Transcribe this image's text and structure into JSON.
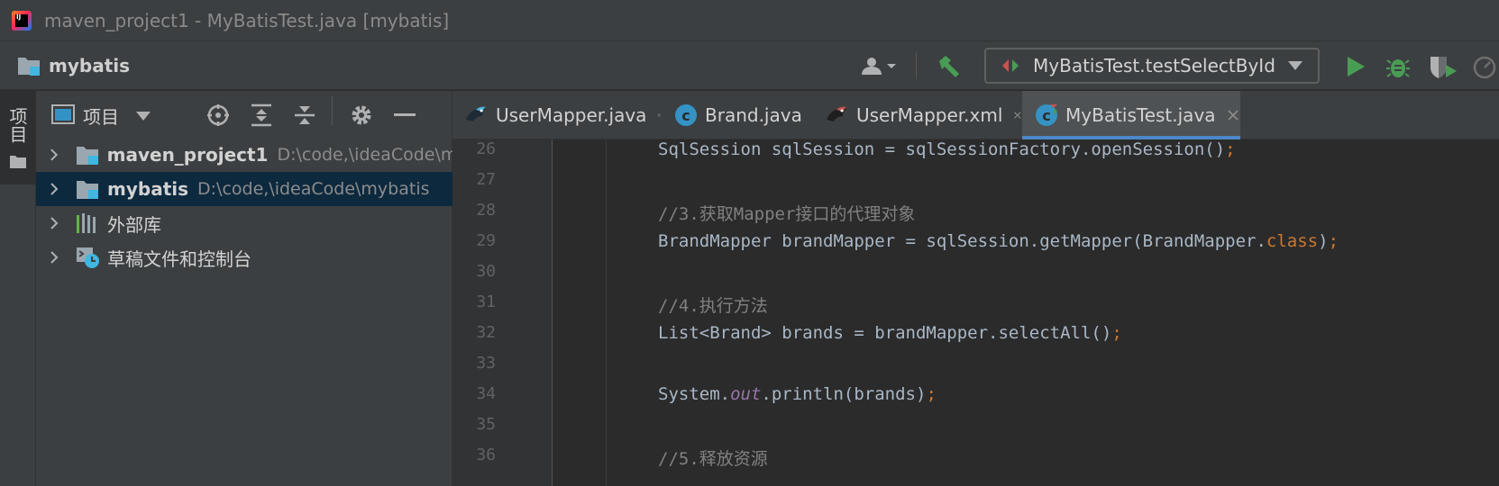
{
  "window": {
    "title": "maven_project1 - MyBatisTest.java [mybatis]",
    "logo_text": "IJ"
  },
  "navbar": {
    "project": "mybatis",
    "run_config": "MyBatisTest.testSelectById"
  },
  "tool_strip": {
    "project_tab_label": "项目"
  },
  "project_panel": {
    "view_label": "项目",
    "tree": [
      {
        "name": "maven_project1",
        "path": "D:\\code,\\ideaCode\\m",
        "icon": "module-folder-icon",
        "bold": true
      },
      {
        "name": "mybatis",
        "path": "D:\\code,\\ideaCode\\mybatis",
        "icon": "module-folder-icon",
        "bold": true,
        "selected": true
      },
      {
        "name": "外部库",
        "path": "",
        "icon": "library-icon",
        "bold": false
      },
      {
        "name": "草稿文件和控制台",
        "path": "",
        "icon": "scratches-icon",
        "bold": false
      }
    ]
  },
  "editor_tabs": [
    {
      "label": "UserMapper.java",
      "icon": "mybatis-mapper-icon",
      "active": false
    },
    {
      "label": "Brand.java",
      "icon": "java-class-icon",
      "active": false
    },
    {
      "label": "UserMapper.xml",
      "icon": "mybatis-xml-icon",
      "active": false
    },
    {
      "label": "MyBatisTest.java",
      "icon": "test-class-icon",
      "active": true
    }
  ],
  "editor": {
    "line_numbers": [
      "26",
      "27",
      "28",
      "29",
      "30",
      "31",
      "32",
      "33",
      "34",
      "35",
      "36"
    ],
    "lines": {
      "l26_code": "SqlSession sqlSession = sqlSessionFactory.openSession()",
      "l26_semi": ";",
      "l28_comment": "//3.获取Mapper接口的代理对象",
      "l29_code": "BrandMapper brandMapper = sqlSession.getMapper(BrandMapper.",
      "l29_kw": "class",
      "l29_close": ")",
      "l29_semi": ";",
      "l31_comment": "//4.执行方法",
      "l32_code": "List<Brand> brands = brandMapper.selectAll()",
      "l32_semi": ";",
      "l34_pre": "System.",
      "l34_field": "out",
      "l34_post": ".println(brands)",
      "l34_semi": ";",
      "l36_comment": "//5.释放资源"
    }
  },
  "colors": {
    "accent": "#4a88c7",
    "keyword": "#cc7832",
    "comment": "#808080",
    "field": "#9876aa",
    "run_green": "#499c54"
  }
}
